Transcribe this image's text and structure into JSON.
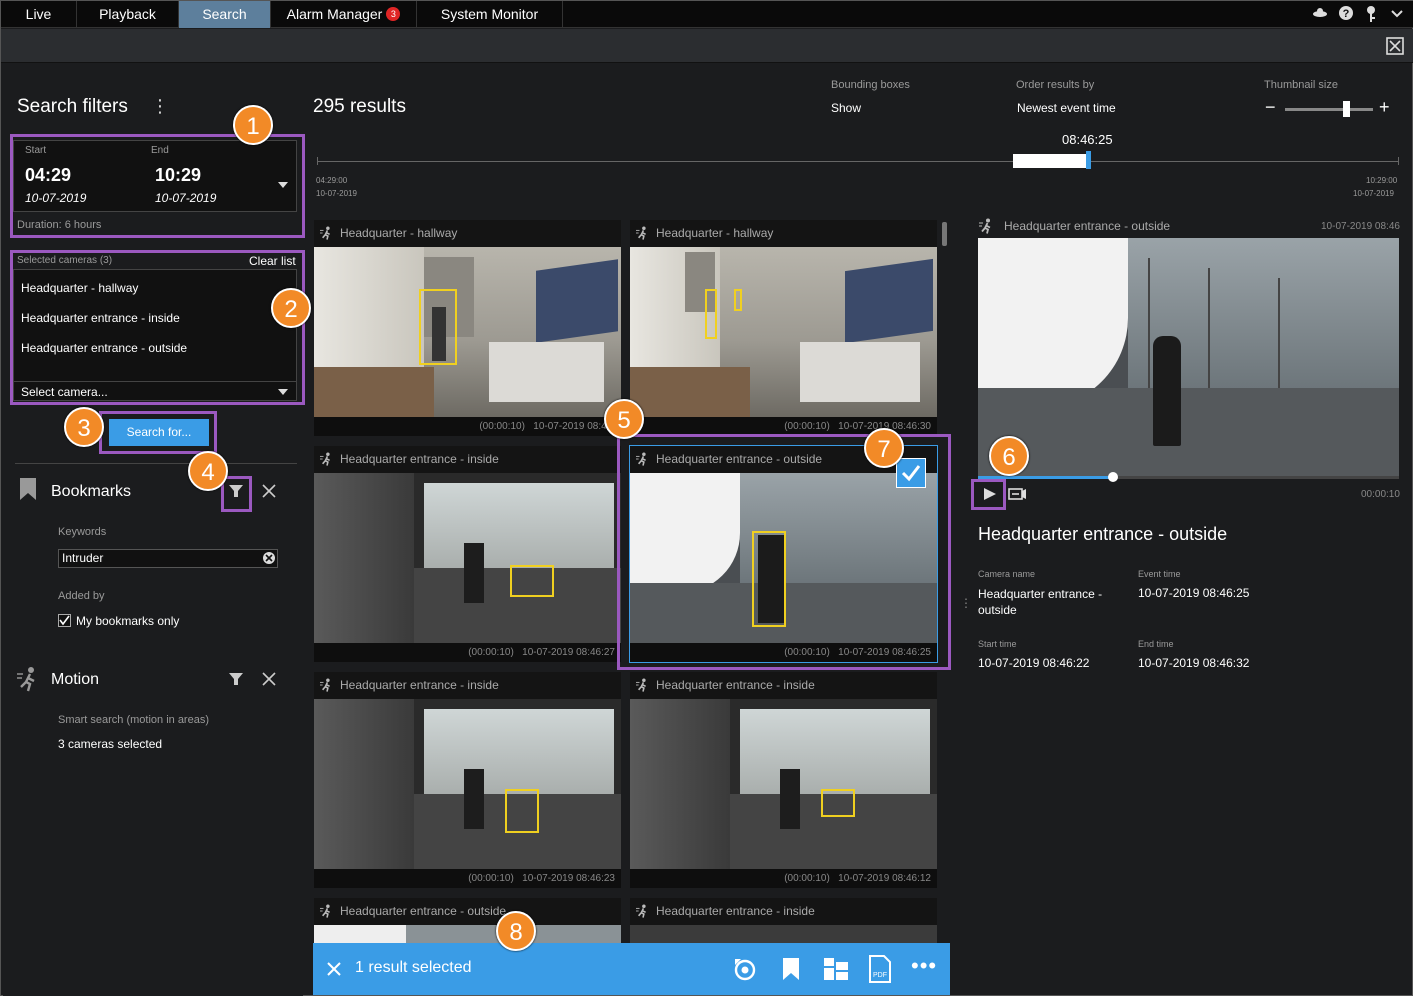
{
  "tabs": [
    {
      "label": "Live"
    },
    {
      "label": "Playback"
    },
    {
      "label": "Search"
    },
    {
      "label": "Alarm Manager",
      "badge": "3"
    },
    {
      "label": "System Monitor"
    }
  ],
  "filters": {
    "title": "Search filters",
    "start_label": "Start",
    "end_label": "End",
    "start_time": "04:29",
    "start_date": "10-07-2019",
    "end_time": "10:29",
    "end_date": "10-07-2019",
    "duration_label": "Duration:",
    "duration_value": "6 hours",
    "selected_cameras_label": "Selected cameras (3)",
    "clear_list": "Clear list",
    "cameras": [
      "Headquarter - hallway",
      "Headquarter entrance - inside",
      "Headquarter entrance - outside"
    ],
    "select_camera": "Select camera...",
    "search_button": "Search for...",
    "bookmarks_title": "Bookmarks",
    "keywords_label": "Keywords",
    "keywords_value": "Intruder",
    "added_by_label": "Added by",
    "my_bookmarks": "My bookmarks only",
    "motion_title": "Motion",
    "smart_search_label": "Smart search (motion in areas)",
    "cameras_selected": "3 cameras selected"
  },
  "results": {
    "count": "295 results",
    "bounding_label": "Bounding boxes",
    "bounding_value": "Show",
    "order_label": "Order results by",
    "order_value": "Newest event time",
    "thumb_label": "Thumbnail size",
    "timeline_current": "08:46:25",
    "timeline_start_time": "04:29:00",
    "timeline_start_date": "10-07-2019",
    "timeline_end_time": "10:29:00",
    "timeline_end_date": "10-07-2019",
    "tiles": [
      {
        "title": "Headquarter - hallway",
        "dur": "(00:00:10)",
        "ts": "10-07-2019  08:46:"
      },
      {
        "title": "Headquarter - hallway",
        "dur": "(00:00:10)",
        "ts": "10-07-2019  08:46:30"
      },
      {
        "title": "Headquarter entrance - inside",
        "dur": "(00:00:10)",
        "ts": "10-07-2019  08:46:27"
      },
      {
        "title": "Headquarter entrance - outside",
        "dur": "(00:00:10)",
        "ts": "10-07-2019  08:46:25"
      },
      {
        "title": "Headquarter entrance - inside",
        "dur": "(00:00:10)",
        "ts": "10-07-2019  08:46:23"
      },
      {
        "title": "Headquarter entrance - inside",
        "dur": "(00:00:10)",
        "ts": "10-07-2019  08:46:12"
      },
      {
        "title": "Headquarter entrance - outside"
      },
      {
        "title": "Headquarter entrance - inside"
      }
    ],
    "action_bar": {
      "selected": "1 result selected"
    }
  },
  "preview": {
    "header_title": "Headquarter entrance - outside",
    "header_date": "10-07-2019 08:46",
    "duration": "00:00:10",
    "progress": 0.32,
    "title": "Headquarter entrance - outside",
    "camera_name_label": "Camera name",
    "camera_name": "Headquarter entrance - outside",
    "event_time_label": "Event time",
    "event_time": "10-07-2019 08:46:25",
    "start_time_label": "Start time",
    "start_time": "10-07-2019 08:46:22",
    "end_time_label": "End time",
    "end_time": "10-07-2019 08:46:32"
  },
  "callouts": [
    "1",
    "2",
    "3",
    "4",
    "5",
    "6",
    "7",
    "8"
  ],
  "colors": {
    "accent": "#3a9ce6",
    "callout": "#f28a27",
    "highlight": "#9b59c0",
    "bbox": "#f0d020",
    "active_tab": "#5d7f9c"
  }
}
